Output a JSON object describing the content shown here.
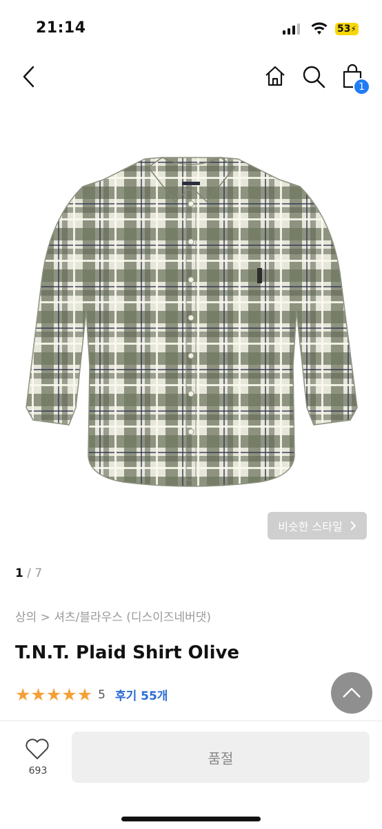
{
  "status": {
    "time": "21:14",
    "battery": "53"
  },
  "nav": {
    "cart_count": "1"
  },
  "similar": {
    "label": "비슷한 스타일"
  },
  "pager": {
    "current": "1",
    "total": " / 7"
  },
  "breadcrumb": "상의 > 셔츠/블라우스 (디스이즈네버댓)",
  "product": {
    "title": "T.N.T. Plaid Shirt Olive"
  },
  "rating": {
    "stars": 5,
    "value": "5",
    "reviews": "후기 55개"
  },
  "bottom": {
    "likes": "693",
    "soldout": "품절"
  },
  "colors": {
    "accent": "#1f7cf5",
    "star": "#f5a037",
    "review_link": "#2b6bd6",
    "shirt_base": "#7a8069"
  },
  "icons": [
    "back-icon",
    "home-icon",
    "search-icon",
    "cart-icon",
    "chevron-right-icon",
    "chevron-up-icon",
    "heart-icon"
  ]
}
